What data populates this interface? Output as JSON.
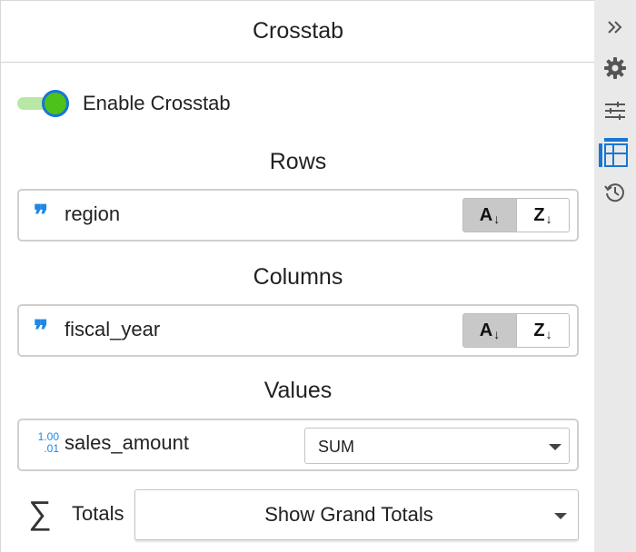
{
  "panel": {
    "title": "Crosstab"
  },
  "enable": {
    "label": "Enable Crosstab",
    "checked": true,
    "accent": "#4cc21a"
  },
  "rows": {
    "title": "Rows",
    "field": {
      "icon": "string-quote-icon",
      "name": "region",
      "sort_asc_label": "A",
      "sort_desc_label": "Z",
      "active_sort": "asc"
    }
  },
  "columns": {
    "title": "Columns",
    "field": {
      "icon": "string-quote-icon",
      "name": "fiscal_year",
      "sort_asc_label": "A",
      "sort_desc_label": "Z",
      "active_sort": "asc"
    }
  },
  "values": {
    "title": "Values",
    "field": {
      "icon": "numeric-icon",
      "icon_text_top": "1.00",
      "icon_text_bottom": ".01",
      "name": "sales_amount",
      "aggregation": "SUM"
    }
  },
  "totals": {
    "label": "Totals",
    "selected": "Show Grand Totals"
  },
  "sidebar": {
    "buttons": [
      {
        "icon": "collapse-double-chevron-icon"
      },
      {
        "icon": "gear-icon"
      },
      {
        "icon": "sliders-icon"
      },
      {
        "icon": "table-grid-icon",
        "active": true
      },
      {
        "icon": "history-icon"
      }
    ]
  },
  "colors": {
    "accent_blue": "#1976d2",
    "icon_blue": "#1e88e5",
    "toggle_green": "#4cc21a"
  }
}
